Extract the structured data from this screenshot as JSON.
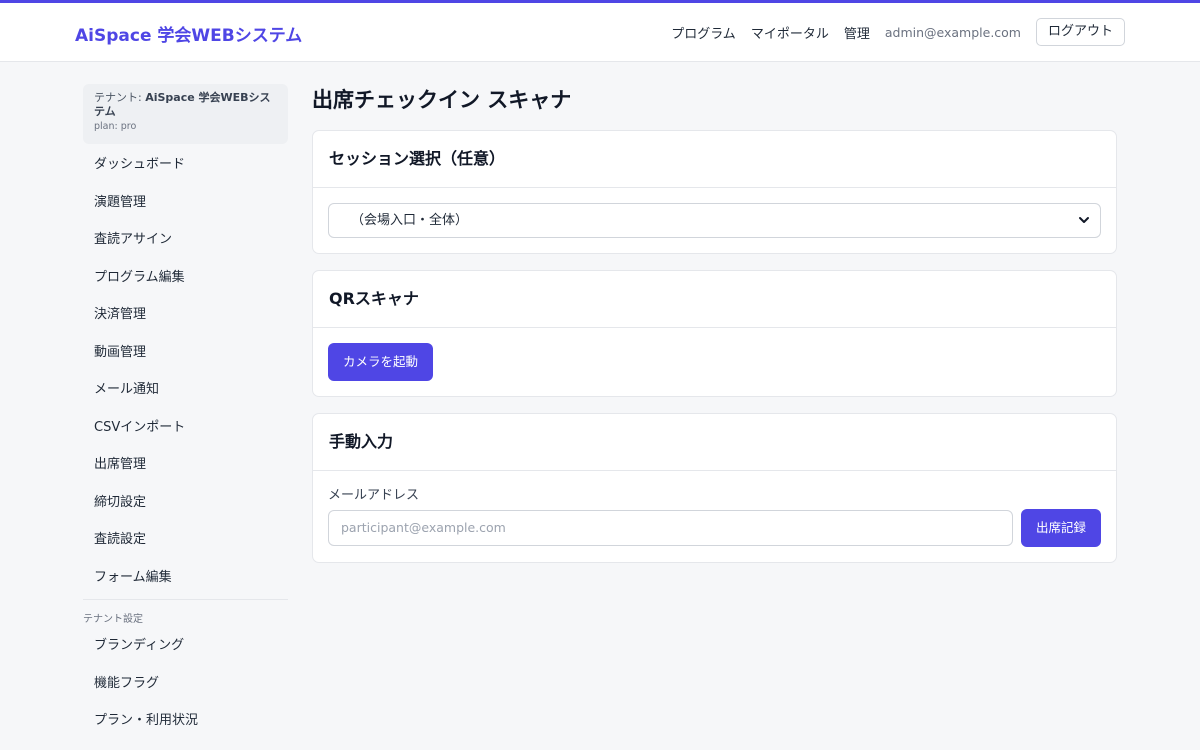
{
  "header": {
    "brand": "AiSpace 学会WEBシステム",
    "nav": [
      "プログラム",
      "マイポータル",
      "管理"
    ],
    "user_email": "admin@example.com",
    "logout_label": "ログアウト",
    "accent_color": "#4f46e5"
  },
  "sidebar": {
    "tenant_prefix": "テナント: ",
    "tenant_name": "AiSpace 学会WEBシステム",
    "tenant_plan": "plan: pro",
    "items": [
      "ダッシュボード",
      "演題管理",
      "査読アサイン",
      "プログラム編集",
      "決済管理",
      "動画管理",
      "メール通知",
      "CSVインポート",
      "出席管理",
      "締切設定",
      "査読設定",
      "フォーム編集"
    ],
    "section_label": "テナント設定",
    "settings_items": [
      "ブランディング",
      "機能フラグ",
      "プラン・利用状況"
    ]
  },
  "main": {
    "title": "出席チェックイン スキャナ",
    "session_card": {
      "title": "セッション選択（任意）",
      "selected_option": "（会場入口・全体）"
    },
    "qr_card": {
      "title": "QRスキャナ",
      "start_camera_label": "カメラを起動"
    },
    "manual_card": {
      "title": "手動入力",
      "email_label": "メールアドレス",
      "email_placeholder": "participant@example.com",
      "submit_label": "出席記録"
    }
  }
}
